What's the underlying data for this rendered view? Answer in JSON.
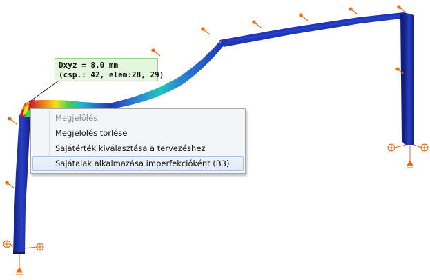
{
  "tooltip": {
    "line1": "Dxyz = 8.0 mm",
    "line2": "(csp.: 42, elem:28, 29)"
  },
  "context_menu": {
    "items": [
      {
        "label": "Megjelölés",
        "enabled": false
      },
      {
        "label": "Megjelölés törlése",
        "enabled": true
      },
      {
        "label": "Sajátérték kiválasztása a tervezéshez",
        "enabled": true
      },
      {
        "label": "Sajátalak alkalmazása imperfekcióként (B3)",
        "enabled": true,
        "highlighted": true
      }
    ]
  },
  "colors": {
    "member_blue": "#1f36b8",
    "member_dark": "#141f7a",
    "load_arrow": "#e86a10",
    "tooltip_bg": "#e3f7dc",
    "menu_highlight": "#dfe8f5"
  }
}
